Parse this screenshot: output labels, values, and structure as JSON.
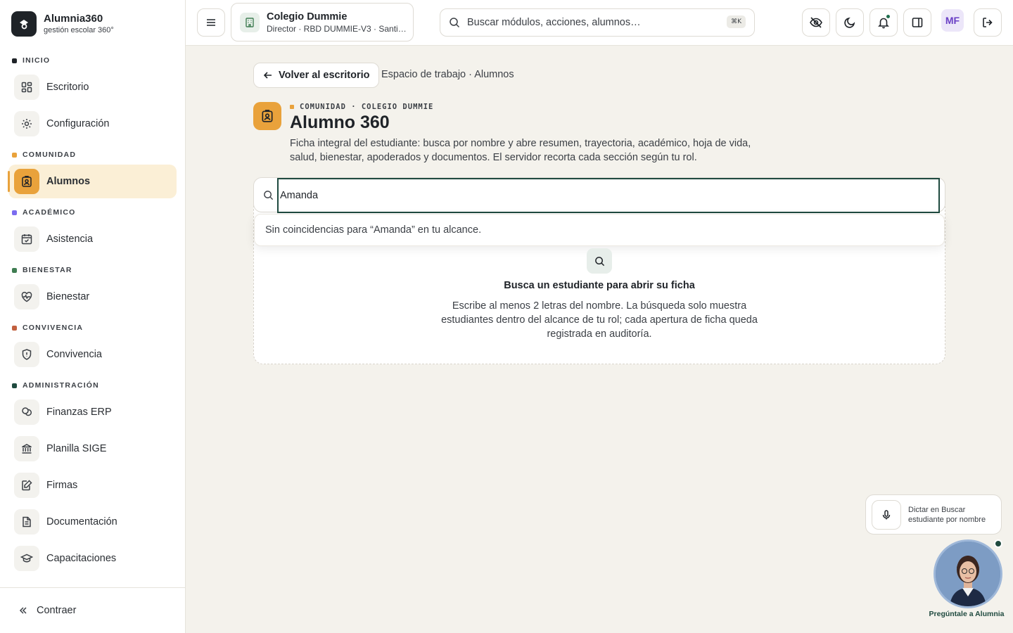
{
  "brand": {
    "title": "Alumnia360",
    "subtitle": "gestión escolar 360°"
  },
  "sidebar": {
    "sections": [
      {
        "label": "INICIO",
        "color": "#1f2328"
      },
      {
        "label": "COMUNIDAD",
        "color": "#e9a23b"
      },
      {
        "label": "ACADÉMICO",
        "color": "#7b6cf0"
      },
      {
        "label": "BIENESTAR",
        "color": "#3f7d52"
      },
      {
        "label": "CONVIVENCIA",
        "color": "#c2603f"
      },
      {
        "label": "ADMINISTRACIÓN",
        "color": "#1f4a3f"
      }
    ],
    "items": {
      "escritorio": "Escritorio",
      "configuracion": "Configuración",
      "alumnos": "Alumnos",
      "asistencia": "Asistencia",
      "bienestar": "Bienestar",
      "convivencia": "Convivencia",
      "finanzas": "Finanzas ERP",
      "sige": "Planilla SIGE",
      "firmas": "Firmas",
      "documentacion": "Documentación",
      "capacitaciones": "Capacitaciones"
    },
    "active_item": "Alumnos",
    "collapse_label": "Contraer"
  },
  "topbar": {
    "school_name": "Colegio Dummie",
    "school_sub": "Director · RBD DUMMIE-V3 · Santia…",
    "search_placeholder": "Buscar módulos, acciones, alumnos…",
    "search_shortcut": "⌘K",
    "avatar_initials": "MF"
  },
  "main": {
    "back_label": "Volver al escritorio",
    "breadcrumb": "Espacio de trabajo · Alumnos",
    "eyebrow": "COMUNIDAD · COLEGIO DUMMIE",
    "title": "Alumno 360",
    "description": "Ficha integral del estudiante: busca por nombre y abre resumen, trayectoria, académico, hoja de vida, salud, bienestar, apoderados y documentos. El servidor recorta cada sección según tu rol.",
    "search_value": "Amanda",
    "no_results": "Sin coincidencias para “Amanda” en tu alcance.",
    "empty_title": "Busca un estudiante para abrir su ficha",
    "empty_desc": "Escribe al menos 2 letras del nombre. La búsqueda solo muestra estudiantes dentro del alcance de tu rol; cada apertura de ficha queda registrada en auditoría."
  },
  "floating": {
    "dictate_label": "Dictar en Buscar estudiante por nombre",
    "assistant_label": "Pregúntale a Alumnia"
  },
  "colors": {
    "accent": "#e9a23b",
    "brand_dark": "#1f4a3f",
    "background": "#f4f2ec"
  }
}
